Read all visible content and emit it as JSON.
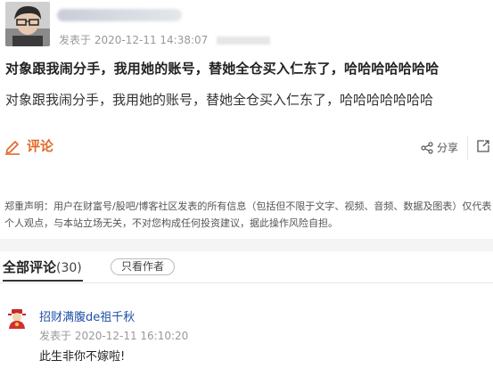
{
  "post": {
    "published_label": "发表于",
    "published_time": "2020-12-11 14:38:07",
    "title": "对象跟我闹分手，我用她的账号，替她全仓买入仁东了，哈哈哈哈哈哈哈",
    "body": "对象跟我闹分手，我用她的账号，替她全仓买入仁东了，哈哈哈哈哈哈哈"
  },
  "actions": {
    "comment_label": "评论",
    "share_label": "分享"
  },
  "disclaimer": "郑重声明：用户在财富号/股吧/博客社区发表的所有信息（包括但不限于文字、视频、音频、数据及图表）仅代表个人观点，与本站立场无关，不对您构成任何投资建议，据此操作风险自担。",
  "comments": {
    "tab_label": "全部评论",
    "count": "(30)",
    "author_only_label": "只看作者",
    "items": [
      {
        "username": "招财满腹de祖千秋",
        "published_label": "发表于",
        "time": "2020-12-11 16:10:20",
        "text": "此生非你不嫁啦!"
      }
    ]
  },
  "colors": {
    "accent": "#e2692a",
    "link": "#1e4fa6"
  }
}
